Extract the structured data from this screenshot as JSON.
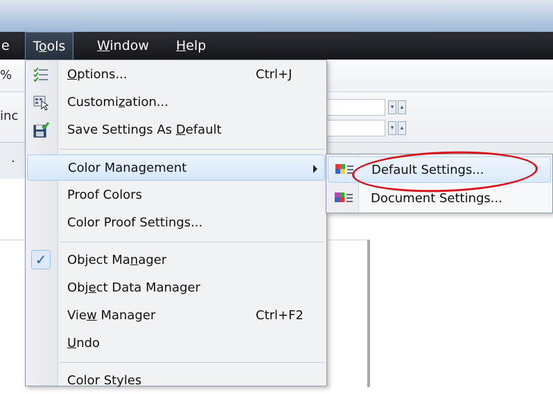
{
  "menubar": {
    "prev_fragment": "e",
    "tools": {
      "pre": "T",
      "accel": "o",
      "post": "ols"
    },
    "window": {
      "pre": "",
      "accel": "W",
      "post": "indow"
    },
    "help": {
      "pre": "",
      "accel": "H",
      "post": "elp"
    }
  },
  "background": {
    "zoom_fragment": "%",
    "field_fragment": "inc",
    "dot_fragment": "."
  },
  "tools_menu": {
    "options": {
      "pre": "",
      "accel": "O",
      "post": "ptions...",
      "shortcut": "Ctrl+J"
    },
    "customization": {
      "pre": "Customi",
      "accel": "z",
      "post": "ation..."
    },
    "save_settings": {
      "pre": "Save Settings As ",
      "accel": "D",
      "post": "efault"
    },
    "color_management": "Color Management",
    "proof_colors": "Proof Colors",
    "color_proof_settings": "Color Proof Settings...",
    "object_manager": {
      "pre": "Object Ma",
      "accel": "n",
      "post": "ager",
      "check": "✓"
    },
    "object_data_manager": {
      "pre": "Obj",
      "accel": "e",
      "post": "ct Data Manager"
    },
    "view_manager": {
      "pre": "Vie",
      "accel": "w",
      "post": " Manager",
      "shortcut": "Ctrl+F2"
    },
    "undo": {
      "pre": "",
      "accel": "U",
      "post": "ndo"
    },
    "color_styles": "Color Styles"
  },
  "submenu": {
    "default_settings": "Default Settings...",
    "document_settings": "Document Settings..."
  },
  "colors": {
    "menubar_bg": "#15171b",
    "highlight_border": "#a8c8ee",
    "annotation_red": "#d9151c"
  }
}
